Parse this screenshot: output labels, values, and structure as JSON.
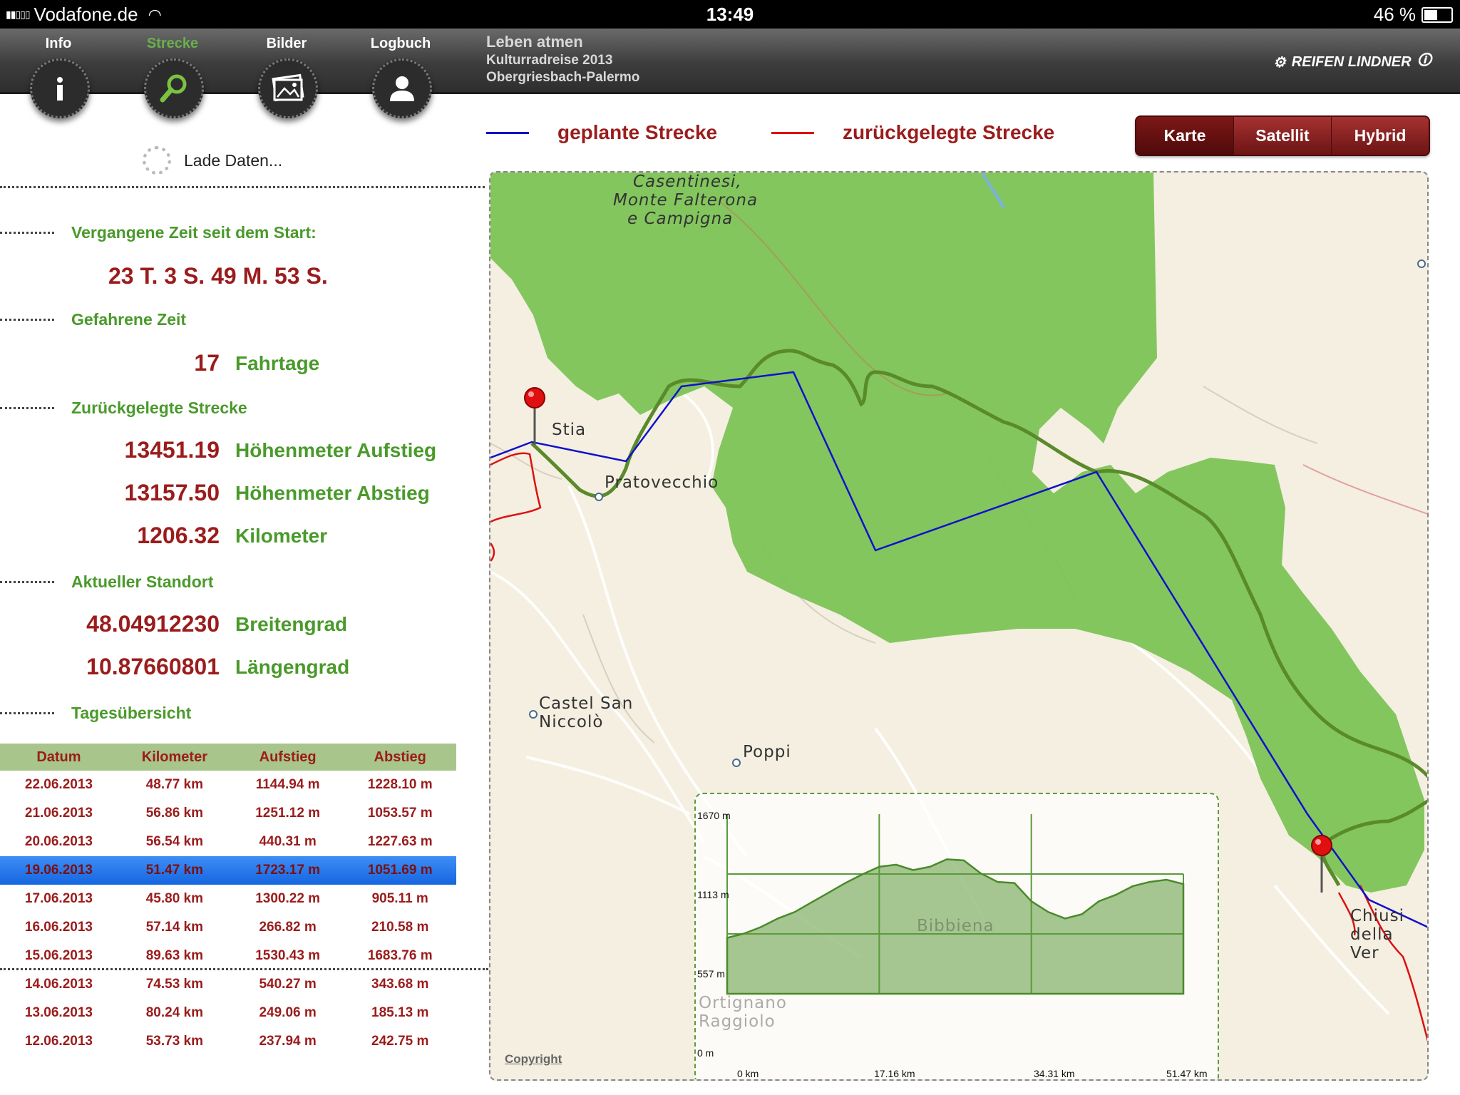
{
  "status_bar": {
    "carrier": "Vodafone.de",
    "time": "13:49",
    "battery": "46 %",
    "battery_level": 0.46
  },
  "nav": {
    "tabs": [
      {
        "label": "Info",
        "icon": "info-icon"
      },
      {
        "label": "Strecke",
        "icon": "search-icon",
        "active": true
      },
      {
        "label": "Bilder",
        "icon": "pictures-icon"
      },
      {
        "label": "Logbuch",
        "icon": "person-icon"
      }
    ],
    "title": "Leben atmen",
    "subtitle1": "Kulturradreise 2013",
    "subtitle2": "Obergriesbach-Palermo",
    "brand": "REIFEN LINDNER"
  },
  "loading": "Lade Daten...",
  "stats": {
    "elapsed_label": "Vergangene Zeit seit dem Start:",
    "elapsed_value": "23 T. 3 S. 49 M. 53 S.",
    "driven_label": "Gefahrene Zeit",
    "driven_value": "17",
    "driven_unit": "Fahrtage",
    "distance_label": "Zurückgelegte Strecke",
    "ascent_value": "13451.19",
    "ascent_unit": "Höhenmeter Aufstieg",
    "descent_value": "13157.50",
    "descent_unit": "Höhenmeter Abstieg",
    "km_value": "1206.32",
    "km_unit": "Kilometer",
    "location_label": "Aktueller Standort",
    "lat_value": "48.04912230",
    "lat_unit": "Breitengrad",
    "lon_value": "10.87660801",
    "lon_unit": "Längengrad",
    "daily_label": "Tagesübersicht"
  },
  "table": {
    "headers": [
      "Datum",
      "Kilometer",
      "Aufstieg",
      "Abstieg"
    ],
    "rows": [
      [
        "22.06.2013",
        "48.77 km",
        "1144.94 m",
        "1228.10 m"
      ],
      [
        "21.06.2013",
        "56.86 km",
        "1251.12 m",
        "1053.57 m"
      ],
      [
        "20.06.2013",
        "56.54 km",
        "440.31 m",
        "1227.63 m"
      ],
      [
        "19.06.2013",
        "51.47 km",
        "1723.17 m",
        "1051.69 m"
      ],
      [
        "17.06.2013",
        "45.80 km",
        "1300.22 m",
        "905.11 m"
      ],
      [
        "16.06.2013",
        "57.14 km",
        "266.82 m",
        "210.58 m"
      ],
      [
        "15.06.2013",
        "89.63 km",
        "1530.43 m",
        "1683.76 m"
      ],
      [
        "14.06.2013",
        "74.53 km",
        "540.27 m",
        "343.68 m"
      ],
      [
        "13.06.2013",
        "80.24 km",
        "249.06 m",
        "185.13 m"
      ],
      [
        "12.06.2013",
        "53.73 km",
        "237.94 m",
        "242.75 m"
      ]
    ],
    "selected_index": 3
  },
  "legend": {
    "planned": "geplante Strecke",
    "planned_color": "#1010cc",
    "traveled": "zurückgelegte Strecke",
    "traveled_color": "#dd1111"
  },
  "map_types": [
    "Karte",
    "Satellit",
    "Hybrid"
  ],
  "map": {
    "labels": {
      "park": "Casentinesi,",
      "park2": "Monte Falterona",
      "park3": "e Campigna",
      "stia": "Stia",
      "pratovecchio": "Pratovecchio",
      "castel1": "Castel San",
      "castel2": "Niccolò",
      "poppi": "Poppi",
      "bibbiena": "Bibbiena",
      "ortignano1": "Ortignano",
      "ortignano2": "Raggiolo",
      "chiusi1": "Chiusi",
      "chiusi2": "della Ver"
    },
    "copyright": "Copyright"
  },
  "elevation": {
    "y_ticks": [
      "1670 m",
      "1113 m",
      "557 m",
      "0 m"
    ],
    "x_ticks": [
      "0 km",
      "17.16 km",
      "34.31 km",
      "51.47 km"
    ],
    "profile_m": [
      520,
      560,
      620,
      700,
      760,
      850,
      940,
      1030,
      1110,
      1180,
      1200,
      1150,
      1180,
      1250,
      1240,
      1120,
      1040,
      1030,
      860,
      760,
      700,
      740,
      860,
      920,
      1000,
      1040,
      1060,
      1020
    ]
  }
}
